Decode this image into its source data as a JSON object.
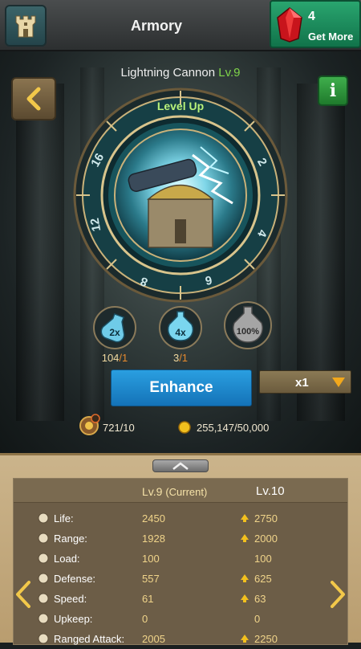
{
  "header": {
    "title": "Armory",
    "gems_count": "4",
    "get_more_label": "Get More"
  },
  "item": {
    "name": "Lightning Cannon",
    "level": "Lv.9",
    "level_up_label": "Level Up",
    "wheel_numbers": [
      "2",
      "4",
      "6",
      "8",
      "12",
      "16"
    ]
  },
  "potions": [
    {
      "label": "2x",
      "count": "104",
      "denominator": "/1"
    },
    {
      "label": "4x",
      "count": "3",
      "denominator": "/1"
    },
    {
      "label": "100%",
      "count": "",
      "denominator": ""
    }
  ],
  "actions": {
    "enhance_label": "Enhance",
    "multiplier": "x1"
  },
  "resources": {
    "tokens": "721/10",
    "gold": "255,147/50,000"
  },
  "stats": {
    "current_header": "Lv.9",
    "current_suffix": "(Current)",
    "next_header": "Lv.10",
    "rows": [
      {
        "icon": "heart-icon",
        "label": "Life:",
        "current": "2450",
        "next": "2750",
        "up": true
      },
      {
        "icon": "range-icon",
        "label": "Range:",
        "current": "1928",
        "next": "2000",
        "up": true
      },
      {
        "icon": "load-icon",
        "label": "Load:",
        "current": "100",
        "next": "100",
        "up": false
      },
      {
        "icon": "shield-icon",
        "label": "Defense:",
        "current": "557",
        "next": "625",
        "up": true
      },
      {
        "icon": "speed-icon",
        "label": "Speed:",
        "current": "61",
        "next": "63",
        "up": true
      },
      {
        "icon": "upkeep-icon",
        "label": "Upkeep:",
        "current": "0",
        "next": "0",
        "up": false
      },
      {
        "icon": "ranged-attack-icon",
        "label": "Ranged Attack:",
        "current": "2005",
        "next": "2250",
        "up": true
      }
    ]
  },
  "colors": {
    "accent_green": "#7fd44a",
    "enhance_blue": "#1f8fd4",
    "stat_value": "#f0d48a"
  }
}
